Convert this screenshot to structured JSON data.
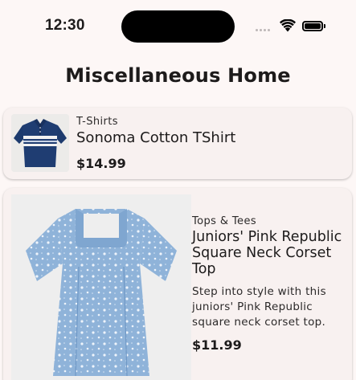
{
  "status_bar": {
    "time": "12:30"
  },
  "header": {
    "title": "Miscellaneous Home"
  },
  "products": [
    {
      "category": "T-Shirts",
      "name": "Sonoma Cotton TShirt",
      "price": "$14.99",
      "image": "navy-polo-shirt"
    },
    {
      "category": "Tops & Tees",
      "name": "Juniors' Pink Republic Square Neck Corset Top",
      "description": "Step into style with this juniors' Pink Republic square neck corset top.",
      "price": "$11.99",
      "image": "blue-floral-top"
    }
  ],
  "colors": {
    "background": "#fdf7f6",
    "card": "#f8f1f0",
    "text": "#1d1b1b"
  }
}
